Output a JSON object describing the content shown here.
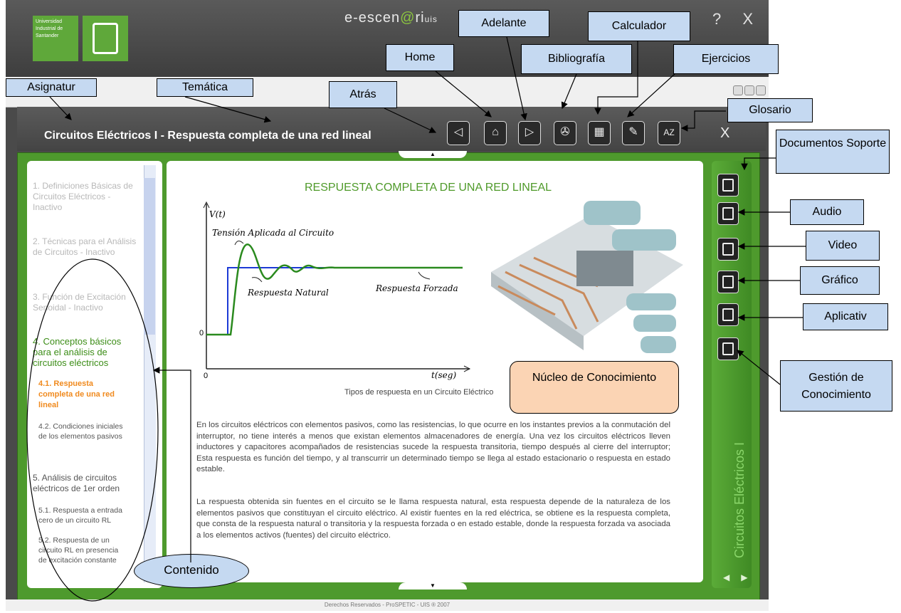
{
  "app": {
    "brand_main": "e-escen",
    "brand_at": "@",
    "brand_ri": "ri",
    "brand_uis": "uis",
    "window_controls": "C ? X",
    "logo_text": "Universidad Industrial de Santander"
  },
  "header": {
    "course_title": "Circuitos Eléctricos I - Respuesta completa de una red lineal",
    "close": "X"
  },
  "sidebar": {
    "items": [
      {
        "label": "1. Definiciones Básicas de Circuitos Eléctricos - Inactivo"
      },
      {
        "label": "2. Técnicas para el Análisis de Circuitos - Inactivo"
      },
      {
        "label": "3. Función de Excitación Senoidal - Inactivo"
      },
      {
        "label": "4. Conceptos básicos para el análisis de circuitos eléctricos"
      },
      {
        "label": "4.1. Respuesta completa de una red lineal"
      },
      {
        "label": "4.2. Condiciones iniciales de los elementos pasivos"
      },
      {
        "label": "5. Análisis de circuitos eléctricos de 1er orden"
      },
      {
        "label": "5.1. Respuesta a entrada cero de un circuito RL"
      },
      {
        "label": "5.2. Respuesta de un circuito RL en presencia de excitación constante"
      }
    ]
  },
  "content": {
    "title": "RESPUESTA COMPLETA DE UNA RED LINEAL",
    "caption": "Tipos de respuesta en un Circuito Eléctrico",
    "para1": "En los circuitos eléctricos con elementos pasivos, como las resistencias, lo que ocurre en los instantes previos a la conmutación del interruptor, no tiene interés a menos que existan elementos almacenadores de energía. Una vez los circuitos eléctricos lleven inductores y capacitores acompañados de resistencias sucede la respuesta transitoria, tiempo después al cierre del interruptor; Esta respuesta es función del tiempo, y al transcurrir un determinado tiempo se llega al estado estacionario o respuesta en estado estable.",
    "para2": "La respuesta obtenida sin fuentes en el circuito se le llama respuesta natural, esta respuesta depende de la naturaleza de los elementos pasivos que constituyan el circuito eléctrico. Al existir fuentes en la red eléctrica, se obtiene es la respuesta completa, que consta de la respuesta natural o transitoria y la respuesta forzada o en estado estable, donde la respuesta forzada va asociada a los elementos activos (fuentes) del circuito eléctrico."
  },
  "graph": {
    "y_label": "V(t)",
    "x_label": "t(seg)",
    "origin_y": "0",
    "origin_x": "0",
    "applied": "Tensión Aplicada al Circuito",
    "natural": "Respuesta Natural",
    "forced": "Respuesta Forzada"
  },
  "side_title": "Circuitos Eléctricos I",
  "footer": "Derechos Reservados - ProSPETIC - UIS ® 2007",
  "callouts": {
    "asignatura": "Asignatur",
    "tematica": "Temática",
    "atras": "Atrás",
    "home": "Home",
    "adelante": "Adelante",
    "bibliografia": "Bibliografía",
    "calculadora": "Calculador",
    "ejercicios": "Ejercicios",
    "glosario": "Glosario",
    "documentos": "Documentos Soporte",
    "audio": "Audio",
    "video": "Video",
    "grafico": "Gráfico",
    "aplicativo": "Aplicativ",
    "gestion": "Gestión de Conocimiento",
    "nucleo": "Núcleo de Conocimiento",
    "contenido": "Contenido"
  },
  "colors": {
    "green": "#4e9a2d",
    "callout": "#c5d9f1",
    "nucleo": "#fbd4b4",
    "orange": "#f08a1e"
  }
}
